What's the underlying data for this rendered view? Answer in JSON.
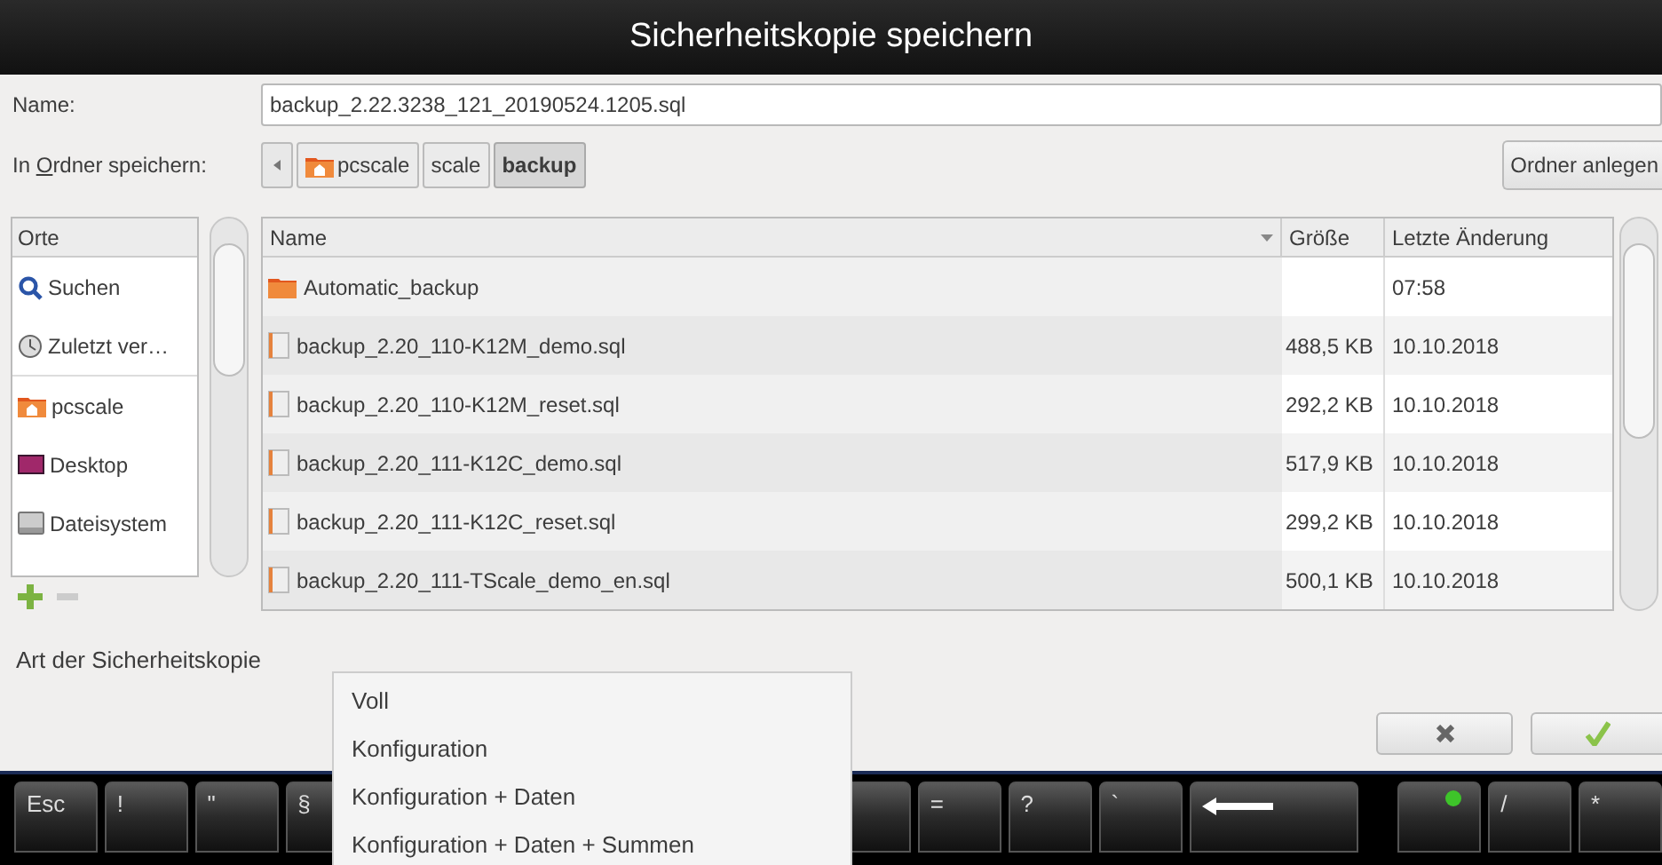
{
  "window": {
    "title": "Sicherheitskopie speichern"
  },
  "name_field": {
    "label": "Name:",
    "value": "backup_2.22.3238_121_20190524.1205.sql"
  },
  "folder_path": {
    "label_before": "In ",
    "label_mnemonic": "O",
    "label_after": "rdner speichern:",
    "crumbs": [
      {
        "label": "pcscale",
        "kind": "home",
        "selected": false
      },
      {
        "label": "scale",
        "kind": "folder",
        "selected": false
      },
      {
        "label": "backup",
        "kind": "folder",
        "selected": true
      }
    ],
    "create_folder_button": "Ordner anlegen"
  },
  "places": {
    "header": "Orte",
    "items": [
      {
        "label": "Suchen",
        "kind": "search"
      },
      {
        "label": "Zuletzt ver…",
        "kind": "recent"
      },
      {
        "label": "pcscale",
        "kind": "home"
      },
      {
        "label": "Desktop",
        "kind": "desktop"
      },
      {
        "label": "Dateisystem",
        "kind": "drive"
      }
    ]
  },
  "table": {
    "columns": [
      "Name",
      "Größe",
      "Letzte Änderung"
    ],
    "rows": [
      {
        "kind": "folder",
        "name": "Automatic_backup",
        "size": "",
        "modified": "07:58"
      },
      {
        "kind": "file",
        "name": "backup_2.20_110-K12M_demo.sql",
        "size": "488,5 KB",
        "modified": "10.10.2018"
      },
      {
        "kind": "file",
        "name": "backup_2.20_110-K12M_reset.sql",
        "size": "292,2 KB",
        "modified": "10.10.2018"
      },
      {
        "kind": "file",
        "name": "backup_2.20_111-K12C_demo.sql",
        "size": "517,9 KB",
        "modified": "10.10.2018"
      },
      {
        "kind": "file",
        "name": "backup_2.20_111-K12C_reset.sql",
        "size": "299,2 KB",
        "modified": "10.10.2018"
      },
      {
        "kind": "file",
        "name": "backup_2.20_111-TScale_demo_en.sql",
        "size": "500,1 KB",
        "modified": "10.10.2018"
      }
    ]
  },
  "backup_type": {
    "label": "Art der Sicherheitskopie",
    "options": [
      "Voll",
      "Konfiguration",
      "Konfiguration + Daten",
      "Konfiguration + Daten + Summen"
    ]
  },
  "keyboard": {
    "keys": [
      {
        "kind": "text",
        "label": "Esc"
      },
      {
        "kind": "text",
        "label": "!"
      },
      {
        "kind": "text",
        "label": "\""
      },
      {
        "kind": "text",
        "label": "§"
      },
      {
        "kind": "hidden"
      },
      {
        "kind": "hidden"
      },
      {
        "kind": "hidden"
      },
      {
        "kind": "hidden"
      },
      {
        "kind": "hidden"
      },
      {
        "kind": "hidden"
      },
      {
        "kind": "text",
        "label": "="
      },
      {
        "kind": "text",
        "label": "?"
      },
      {
        "kind": "text",
        "label": "`"
      },
      {
        "kind": "backspace"
      },
      {
        "kind": "gap"
      },
      {
        "kind": "led"
      },
      {
        "kind": "text",
        "label": "/"
      },
      {
        "kind": "text",
        "label": "*"
      }
    ]
  }
}
